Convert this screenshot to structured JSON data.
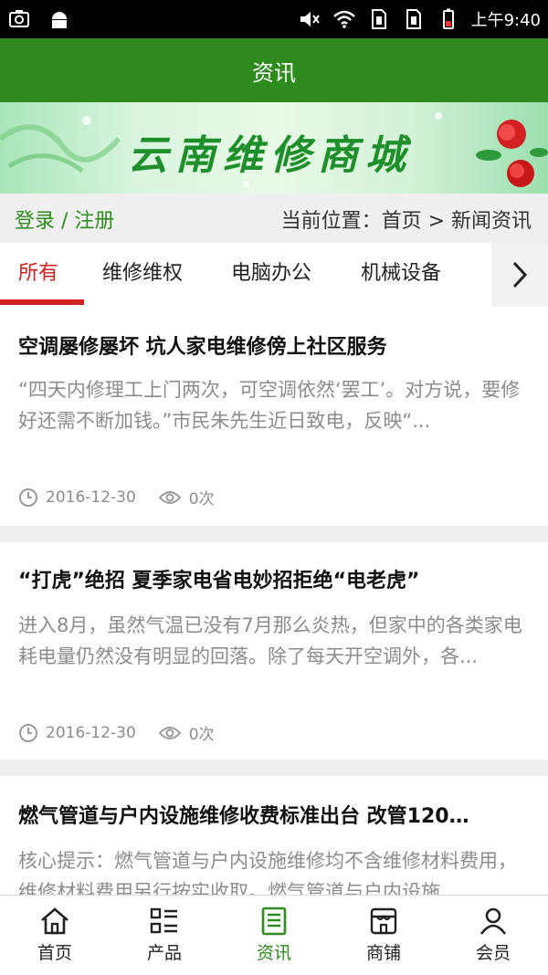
{
  "status_bar": {
    "time": "上午9:40",
    "icons": [
      "screenshot-icon",
      "android-icon",
      "mute-icon",
      "wifi-icon",
      "sim1-icon",
      "sim2-icon",
      "battery-icon"
    ]
  },
  "header": {
    "title": "资讯"
  },
  "banner": {
    "text": "云南维修商城"
  },
  "crumb_bar": {
    "login_label": "登录 / 注册",
    "location_label": "当前位置：首页 > 新闻资讯"
  },
  "tabs": [
    {
      "label": "所有"
    },
    {
      "label": "维修维权"
    },
    {
      "label": "电脑办公"
    },
    {
      "label": "机械设备"
    }
  ],
  "articles": [
    {
      "title": "空调屡修屡坏 坑人家电维修傍上社区服务",
      "summary": "“四天内修理工上门两次，可空调依然‘罢工’。对方说，要修好还需不断加钱。”市民朱先生近日致电，反映“...",
      "date": "2016-12-30",
      "views": "0次"
    },
    {
      "title": "“打虎”绝招 夏季家电省电妙招拒绝“电老虎”",
      "summary": "进入8月，虽然气温已没有7月那么炎热，但家中的各类家电耗电量仍然没有明显的回落。除了每天开空调外，各...",
      "date": "2016-12-30",
      "views": "0次"
    },
    {
      "title": "燃气管道与户内设施维修收费标准出台 改管120…",
      "summary": "核心提示：燃气管道与户内设施维修均不含维修材料费用，维修材料费用另行按实收取。燃气管道与户内设施",
      "date": "",
      "views": ""
    }
  ],
  "bottom_nav": [
    {
      "label": "首页",
      "icon": "home-icon"
    },
    {
      "label": "产品",
      "icon": "product-grid-icon"
    },
    {
      "label": "资讯",
      "icon": "news-icon"
    },
    {
      "label": "商铺",
      "icon": "shop-icon"
    },
    {
      "label": "会员",
      "icon": "member-icon"
    }
  ],
  "colors": {
    "primary_green": "#2e8b1e",
    "tab_active_red": "#d21f1f"
  }
}
